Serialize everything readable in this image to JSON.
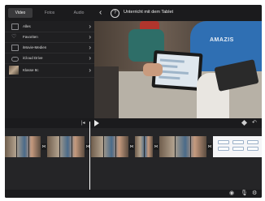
{
  "top_bar": {
    "segments": [
      "Video",
      "Fotos",
      "Audio"
    ],
    "selected_segment": "Video",
    "title": "Unterricht mit dem Tablet"
  },
  "library": {
    "items": [
      {
        "label": "Alles",
        "icon": "film-icon"
      },
      {
        "label": "Favoriten",
        "icon": "heart-icon"
      },
      {
        "label": "iMovie-Medien",
        "icon": "film-icon"
      },
      {
        "label": "iCloud Drive",
        "icon": "cloud-icon"
      },
      {
        "label": "Klasse 8c",
        "icon": "album-thumbnail"
      }
    ]
  },
  "viewer": {
    "shirt_text": "AMAZIS"
  },
  "icons": {
    "back": "‹",
    "help": "?",
    "chevron": "›",
    "skip_back": "|◂",
    "undo": "↶",
    "transition": "⋈",
    "camera": "◉",
    "mic": "🎙",
    "settings": "⚙"
  }
}
